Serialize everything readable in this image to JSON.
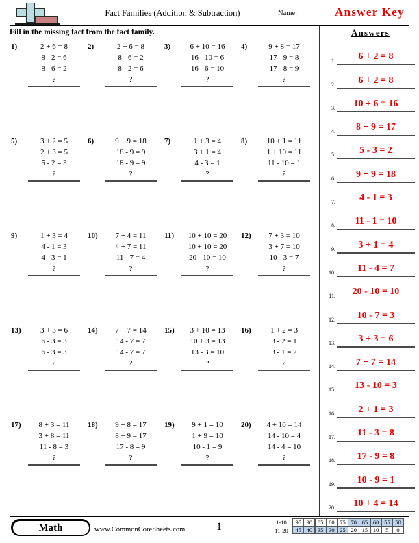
{
  "header": {
    "logo_icon": "plus-minus-icon",
    "title": "Fact Families (Addition & Subtraction)",
    "name_label": "Name:",
    "answer_key_label": "Answer Key"
  },
  "instructions": "Fill in the missing fact from the fact family.",
  "problems": [
    {
      "number": "1)",
      "lines": [
        "2 + 6 = 8",
        "8 - 2 = 6",
        "8 - 6 = 2"
      ],
      "missing": "?"
    },
    {
      "number": "2)",
      "lines": [
        "2 + 6 = 8",
        "8 - 6 = 2",
        "8 - 2 = 6"
      ],
      "missing": "?"
    },
    {
      "number": "3)",
      "lines": [
        "6 + 10 = 16",
        "16 - 10 = 6",
        "16 - 6 = 10"
      ],
      "missing": "?"
    },
    {
      "number": "4)",
      "lines": [
        "9 + 8 = 17",
        "17 - 9 = 8",
        "17 - 8 = 9"
      ],
      "missing": "?"
    },
    {
      "number": "5)",
      "lines": [
        "3 + 2 = 5",
        "2 + 3 = 5",
        "5 - 2 = 3"
      ],
      "missing": "?"
    },
    {
      "number": "6)",
      "lines": [
        "9 + 9 = 18",
        "18 - 9 = 9",
        "18 - 9 = 9"
      ],
      "missing": "?"
    },
    {
      "number": "7)",
      "lines": [
        "1 + 3 = 4",
        "3 + 1 = 4",
        "4 - 3 = 1"
      ],
      "missing": "?"
    },
    {
      "number": "8)",
      "lines": [
        "10 + 1 = 11",
        "1 + 10 = 11",
        "11 - 10 = 1"
      ],
      "missing": "?"
    },
    {
      "number": "9)",
      "lines": [
        "1 + 3 = 4",
        "4 - 1 = 3",
        "4 - 3 = 1"
      ],
      "missing": "?"
    },
    {
      "number": "10)",
      "lines": [
        "7 + 4 = 11",
        "4 + 7 = 11",
        "11 - 7 = 4"
      ],
      "missing": "?"
    },
    {
      "number": "11)",
      "lines": [
        "10 + 10 = 20",
        "10 + 10 = 20",
        "20 - 10 = 10"
      ],
      "missing": "?"
    },
    {
      "number": "12)",
      "lines": [
        "7 + 3 = 10",
        "3 + 7 = 10",
        "10 - 3 = 7"
      ],
      "missing": "?"
    },
    {
      "number": "13)",
      "lines": [
        "3 + 3 = 6",
        "6 - 3 = 3",
        "6 - 3 = 3"
      ],
      "missing": "?"
    },
    {
      "number": "14)",
      "lines": [
        "7 + 7 = 14",
        "14 - 7 = 7",
        "14 - 7 = 7"
      ],
      "missing": "?"
    },
    {
      "number": "15)",
      "lines": [
        "3 + 10 = 13",
        "10 + 3 = 13",
        "13 - 3 = 10"
      ],
      "missing": "?"
    },
    {
      "number": "16)",
      "lines": [
        "1 + 2 = 3",
        "3 - 2 = 1",
        "3 - 1 = 2"
      ],
      "missing": "?"
    },
    {
      "number": "17)",
      "lines": [
        "8 + 3 = 11",
        "3 + 8 = 11",
        "11 - 8 = 3"
      ],
      "missing": "?"
    },
    {
      "number": "18)",
      "lines": [
        "9 + 8 = 17",
        "8 + 9 = 17",
        "17 - 8 = 9"
      ],
      "missing": "?"
    },
    {
      "number": "19)",
      "lines": [
        "9 + 1 = 10",
        "1 + 9 = 10",
        "10 - 1 = 9"
      ],
      "missing": "?"
    },
    {
      "number": "20)",
      "lines": [
        "4 + 10 = 14",
        "14 - 10 = 4",
        "14 - 4 = 10"
      ],
      "missing": "?"
    }
  ],
  "answers": {
    "heading": "Answers",
    "color": "#ee0000",
    "items": [
      {
        "number": "1.",
        "value": "6 + 2 = 8"
      },
      {
        "number": "2.",
        "value": "6 + 2 = 8"
      },
      {
        "number": "3.",
        "value": "10 + 6 = 16"
      },
      {
        "number": "4.",
        "value": "8 + 9 = 17"
      },
      {
        "number": "5.",
        "value": "5 - 3 = 2"
      },
      {
        "number": "6.",
        "value": "9 + 9 = 18"
      },
      {
        "number": "7.",
        "value": "4 - 1 = 3"
      },
      {
        "number": "8.",
        "value": "11 - 1 = 10"
      },
      {
        "number": "9.",
        "value": "3 + 1 = 4"
      },
      {
        "number": "10.",
        "value": "11 - 4 = 7"
      },
      {
        "number": "11.",
        "value": "20 - 10 = 10"
      },
      {
        "number": "12.",
        "value": "10 - 7 = 3"
      },
      {
        "number": "13.",
        "value": "3 + 3 = 6"
      },
      {
        "number": "14.",
        "value": "7 + 7 = 14"
      },
      {
        "number": "15.",
        "value": "13 - 10 = 3"
      },
      {
        "number": "16.",
        "value": "2 + 1 = 3"
      },
      {
        "number": "17.",
        "value": "11 - 3 = 8"
      },
      {
        "number": "18.",
        "value": "17 - 9 = 8"
      },
      {
        "number": "19.",
        "value": "10 - 9 = 1"
      },
      {
        "number": "20.",
        "value": "10 + 4 = 14"
      }
    ]
  },
  "footer": {
    "subject": "Math",
    "url": "www.CommonCoreSheets.com",
    "page_number": "1",
    "score_table": {
      "highlight_color": "#bcd4ee",
      "rows": [
        {
          "label": "1-10",
          "cells": [
            {
              "value": "95",
              "highlighted": false
            },
            {
              "value": "90",
              "highlighted": false
            },
            {
              "value": "85",
              "highlighted": false
            },
            {
              "value": "80",
              "highlighted": false
            },
            {
              "value": "75",
              "highlighted": false
            },
            {
              "value": "70",
              "highlighted": true
            },
            {
              "value": "65",
              "highlighted": true
            },
            {
              "value": "60",
              "highlighted": true
            },
            {
              "value": "55",
              "highlighted": true
            },
            {
              "value": "50",
              "highlighted": true
            }
          ]
        },
        {
          "label": "11-20",
          "cells": [
            {
              "value": "45",
              "highlighted": true
            },
            {
              "value": "40",
              "highlighted": true
            },
            {
              "value": "35",
              "highlighted": true
            },
            {
              "value": "30",
              "highlighted": true
            },
            {
              "value": "25",
              "highlighted": true
            },
            {
              "value": "20",
              "highlighted": false
            },
            {
              "value": "15",
              "highlighted": false
            },
            {
              "value": "10",
              "highlighted": false
            },
            {
              "value": "5",
              "highlighted": false
            },
            {
              "value": "0",
              "highlighted": false
            }
          ]
        }
      ]
    }
  }
}
